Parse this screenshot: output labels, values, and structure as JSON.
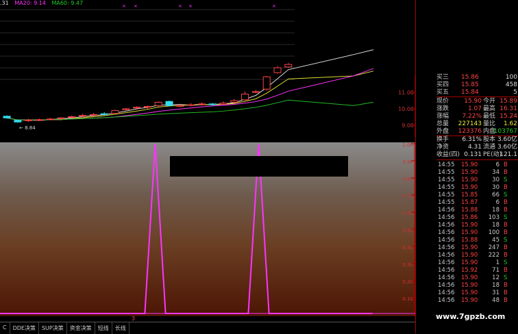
{
  "ma_legend": {
    "prefix": ".31",
    "ma20": "MA20: 9.14",
    "ma60": "MA60: 9.47"
  },
  "kline": {
    "axis_labels": [
      "11.00",
      "10.00",
      "9.00"
    ],
    "low_label": "8.84",
    "candles": [
      {
        "o": 9.55,
        "c": 9.45,
        "h": 9.6,
        "l": 9.4
      },
      {
        "o": 9.3,
        "c": 9.2,
        "h": 9.35,
        "l": 9.15
      },
      {
        "o": 9.3,
        "c": 9.32,
        "h": 9.4,
        "l": 9.2
      },
      {
        "o": 9.32,
        "c": 9.34,
        "h": 9.4,
        "l": 9.28
      },
      {
        "o": 9.35,
        "c": 9.38,
        "h": 9.45,
        "l": 9.3
      },
      {
        "o": 9.4,
        "c": 9.45,
        "h": 9.5,
        "l": 9.35
      },
      {
        "o": 9.48,
        "c": 9.52,
        "h": 9.6,
        "l": 9.45
      },
      {
        "o": 9.55,
        "c": 9.6,
        "h": 9.7,
        "l": 9.5
      },
      {
        "o": 9.62,
        "c": 9.65,
        "h": 9.75,
        "l": 9.55
      },
      {
        "o": 9.7,
        "c": 9.68,
        "h": 9.8,
        "l": 9.6
      },
      {
        "o": 9.72,
        "c": 9.9,
        "h": 9.95,
        "l": 9.7
      },
      {
        "o": 9.95,
        "c": 10.0,
        "h": 10.05,
        "l": 9.9
      },
      {
        "o": 10.05,
        "c": 10.1,
        "h": 10.15,
        "l": 9.95
      },
      {
        "o": 10.1,
        "c": 10.15,
        "h": 10.2,
        "l": 10.0
      },
      {
        "o": 10.2,
        "c": 10.4,
        "h": 10.45,
        "l": 10.15
      },
      {
        "o": 10.45,
        "c": 10.2,
        "h": 10.5,
        "l": 10.15
      },
      {
        "o": 10.15,
        "c": 10.2,
        "h": 10.3,
        "l": 10.1
      },
      {
        "o": 10.2,
        "c": 10.25,
        "h": 10.35,
        "l": 10.15
      },
      {
        "o": 10.28,
        "c": 10.3,
        "h": 10.4,
        "l": 10.2
      },
      {
        "o": 10.3,
        "c": 10.25,
        "h": 10.35,
        "l": 10.2
      },
      {
        "o": 10.28,
        "c": 10.35,
        "h": 10.45,
        "l": 10.25
      },
      {
        "o": 10.4,
        "c": 10.5,
        "h": 10.6,
        "l": 10.35
      },
      {
        "o": 10.55,
        "c": 10.9,
        "h": 11.05,
        "l": 10.5
      },
      {
        "o": 11.0,
        "c": 11.05,
        "h": 11.15,
        "l": 10.95
      },
      {
        "o": 11.2,
        "c": 11.95,
        "h": 12.0,
        "l": 11.1
      },
      {
        "o": 12.2,
        "c": 12.5,
        "h": 12.6,
        "l": 12.15
      },
      {
        "o": 12.55,
        "c": 12.7,
        "h": 12.8,
        "l": 12.5
      }
    ]
  },
  "indicator": {
    "axis_labels": [
      "1.00",
      "0.90",
      "0.80",
      "0.70",
      "0.60",
      "0.50",
      "0.40",
      "0.30",
      "0.20",
      "0.10"
    ],
    "values": [
      0,
      0,
      0,
      0,
      0,
      0,
      0,
      0,
      0,
      0,
      0,
      0,
      0,
      0,
      0,
      1,
      0,
      0,
      0,
      0,
      0,
      0,
      0,
      0,
      0,
      1,
      0,
      0,
      0,
      0,
      0,
      0,
      0,
      0,
      0,
      0,
      0
    ],
    "bottom_label": "3"
  },
  "tabs": [
    "C",
    "DDE决策",
    "SUP决策",
    "资金决策",
    "短线",
    "长线"
  ],
  "quote": {
    "top": [
      {
        "name": "买三",
        "price": "15.86",
        "vol": "100"
      },
      {
        "name": "买四",
        "price": "15.85",
        "vol": "458"
      },
      {
        "name": "买五",
        "price": "15.84",
        "vol": "5"
      }
    ],
    "stats": [
      {
        "l1": "现价",
        "v1": "15.90",
        "l2": "今开",
        "v2": "15.89",
        "v1c": "red",
        "v2c": "red"
      },
      {
        "l1": "涨跌",
        "v1": "1.07",
        "l2": "最高",
        "v2": "16.31",
        "v1c": "red",
        "v2c": "red"
      },
      {
        "l1": "涨幅",
        "v1": "7.22%",
        "l2": "最低",
        "v2": "15.24",
        "v1c": "red",
        "v2c": "red"
      },
      {
        "l1": "总量",
        "v1": "227143",
        "l2": "量比",
        "v2": "1.62",
        "v1c": "yellow",
        "v2c": "yellow"
      },
      {
        "l1": "外盘",
        "v1": "123376",
        "l2": "内盘",
        "v2": "103767",
        "v1c": "red",
        "v2c": "green"
      },
      {
        "l1": "换手",
        "v1": "6.31%",
        "l2": "股本",
        "v2": "3.60亿",
        "v1c": "white",
        "v2c": "white"
      },
      {
        "l1": "净资",
        "v1": "4.31",
        "l2": "流通",
        "v2": "3.60亿",
        "v1c": "white",
        "v2c": "white"
      },
      {
        "l1": "收益(四)",
        "v1": "0.131",
        "l2": "PE(动)",
        "v2": "121.1",
        "v1c": "white",
        "v2c": "white"
      }
    ],
    "ticks": [
      {
        "t": "14:55",
        "p": "15.90",
        "v": "6",
        "s": "B"
      },
      {
        "t": "14:55",
        "p": "15.90",
        "v": "34",
        "s": "B"
      },
      {
        "t": "14:55",
        "p": "15.90",
        "v": "30",
        "s": "S"
      },
      {
        "t": "14:55",
        "p": "15.90",
        "v": "30",
        "s": "B"
      },
      {
        "t": "14:55",
        "p": "15.85",
        "v": "66",
        "s": "S"
      },
      {
        "t": "14:55",
        "p": "15.87",
        "v": "6",
        "s": "B"
      },
      {
        "t": "14:56",
        "p": "15.88",
        "v": "18",
        "s": "B"
      },
      {
        "t": "14:56",
        "p": "15.86",
        "v": "103",
        "s": "S"
      },
      {
        "t": "14:56",
        "p": "15.90",
        "v": "18",
        "s": "B"
      },
      {
        "t": "14:56",
        "p": "15.90",
        "v": "100",
        "s": "B"
      },
      {
        "t": "14:56",
        "p": "15.88",
        "v": "45",
        "s": "S"
      },
      {
        "t": "14:56",
        "p": "15.90",
        "v": "247",
        "s": "B"
      },
      {
        "t": "14:56",
        "p": "15.90",
        "v": "222",
        "s": "B"
      },
      {
        "t": "14:56",
        "p": "15.90",
        "v": "1",
        "s": "S"
      },
      {
        "t": "14:56",
        "p": "15.92",
        "v": "71",
        "s": "B"
      },
      {
        "t": "14:56",
        "p": "15.90",
        "v": "12",
        "s": "S"
      },
      {
        "t": "14:56",
        "p": "15.90",
        "v": "18",
        "s": "B"
      },
      {
        "t": "14:56",
        "p": "15.90",
        "v": "31",
        "s": "B"
      },
      {
        "t": "14:56",
        "p": "15.90",
        "v": "48",
        "s": "B"
      }
    ]
  },
  "watermark": "www.7gpzb.com",
  "colors": {
    "up": "#ff4444",
    "down": "#22cc22",
    "indicator_line": "#ff33ff",
    "ma5": "#dddddd",
    "ma10": "#dddd33",
    "ma20": "#ff33ff",
    "ma60": "#22bb22"
  }
}
